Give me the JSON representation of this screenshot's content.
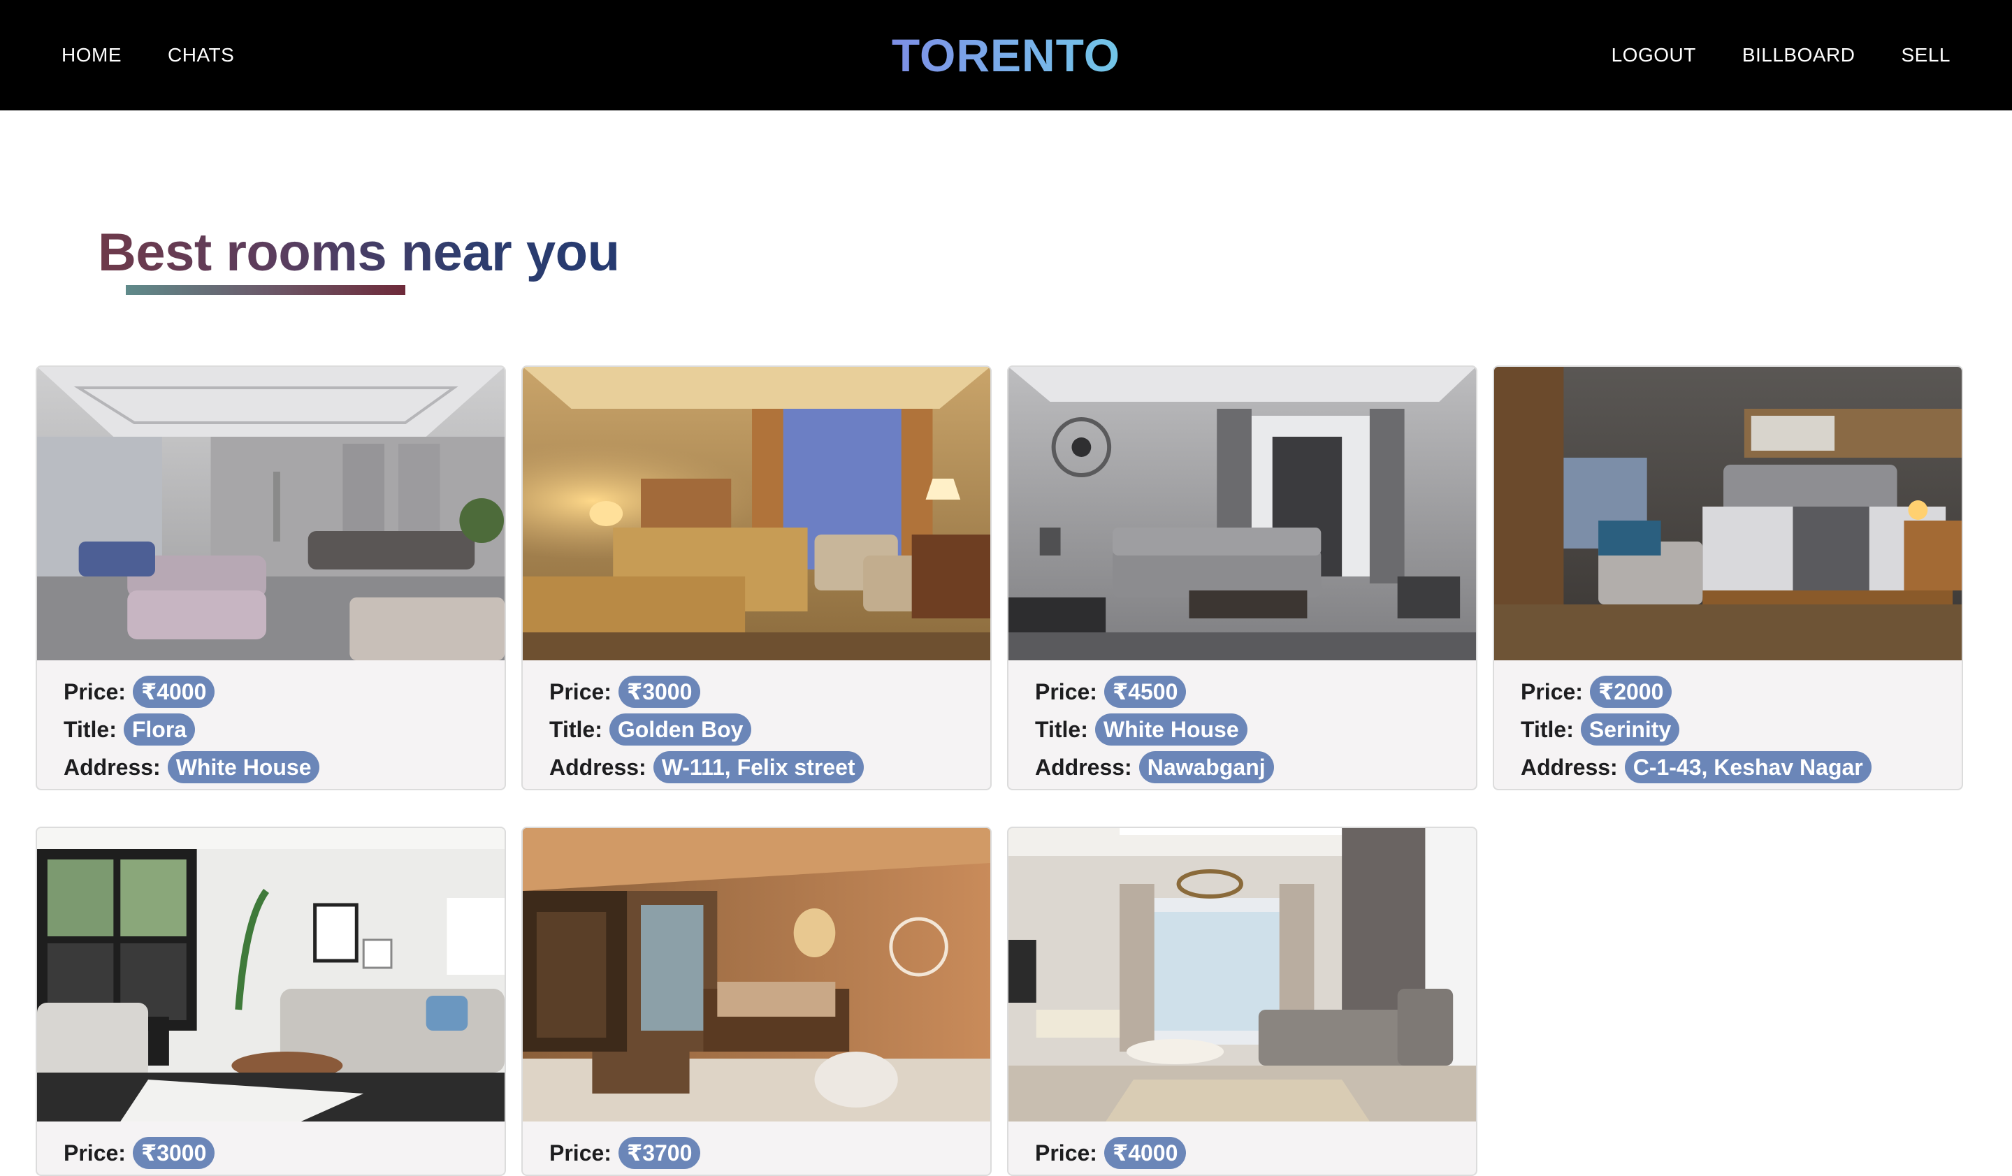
{
  "nav": {
    "left": [
      {
        "label": "HOME"
      },
      {
        "label": "CHATS"
      }
    ],
    "brand": "TORENTO",
    "right": [
      {
        "label": "LOGOUT"
      },
      {
        "label": "BILLBOARD"
      },
      {
        "label": "SELL"
      }
    ]
  },
  "heading": "Best rooms near you",
  "labels": {
    "price": "Price:",
    "title": "Title:",
    "address": "Address:"
  },
  "rooms": [
    {
      "price": "₹4000",
      "title": "Flora",
      "address": "White House"
    },
    {
      "price": "₹3000",
      "title": "Golden Boy",
      "address": "W-111, Felix street"
    },
    {
      "price": "₹4500",
      "title": "White House",
      "address": "Nawabganj"
    },
    {
      "price": "₹2000",
      "title": "Serinity",
      "address": "C-1-43, Keshav Nagar"
    },
    {
      "price": "₹3000",
      "title": "",
      "address": ""
    },
    {
      "price": "₹3700",
      "title": "",
      "address": ""
    },
    {
      "price": "₹4000",
      "title": "",
      "address": ""
    }
  ],
  "colors": {
    "nav_bg": "#000000",
    "pill": "#6b86b8",
    "card_bg": "#f5f3f4"
  }
}
